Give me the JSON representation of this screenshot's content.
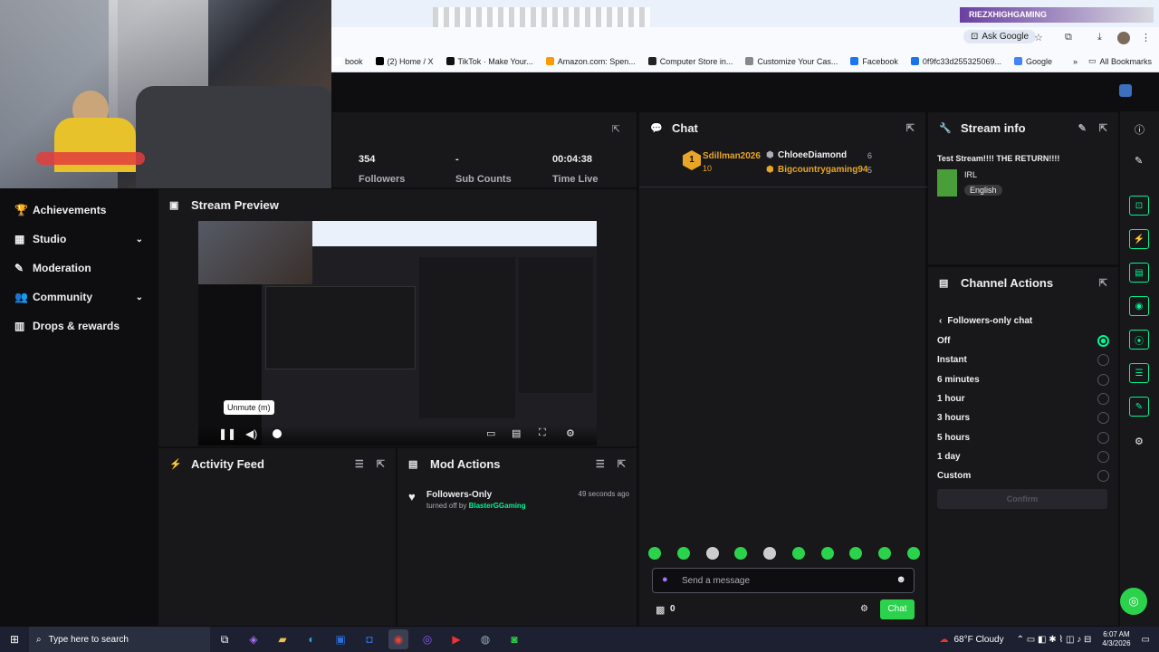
{
  "browser": {
    "profile_banner": "RIEZXHIGHGAMING",
    "ask_google": "Ask Google",
    "bookmarks": [
      {
        "label": "book",
        "color": "#ffffff"
      },
      {
        "label": "(2) Home / X",
        "color": "#000000"
      },
      {
        "label": "TikTok · Make Your...",
        "color": "#111111"
      },
      {
        "label": "Amazon.com: Spen...",
        "color": "#ff9900"
      },
      {
        "label": "Computer Store in...",
        "color": "#222222"
      },
      {
        "label": "Customize Your Cas...",
        "color": "#888888"
      },
      {
        "label": "Facebook",
        "color": "#1877f2"
      },
      {
        "label": "0f9fc33d255325069...",
        "color": "#1a73e8"
      },
      {
        "label": "Google",
        "color": "#4285f4"
      }
    ],
    "all_bookmarks": "All Bookmarks"
  },
  "sidebar": {
    "items": [
      {
        "label": "Achievements",
        "icon": "trophy-icon",
        "chevron": false
      },
      {
        "label": "Studio",
        "icon": "studio-icon",
        "chevron": true
      },
      {
        "label": "Moderation",
        "icon": "wrench-icon",
        "chevron": false
      },
      {
        "label": "Community",
        "icon": "community-icon",
        "chevron": true
      },
      {
        "label": "Drops & rewards",
        "icon": "drops-icon",
        "chevron": false
      }
    ]
  },
  "stats": {
    "followers_value": "354",
    "followers_label": "Followers",
    "subs_value": "-",
    "subs_label": "Sub Counts",
    "time_value": "00:04:38",
    "time_label": "Time Live"
  },
  "preview": {
    "title": "Stream Preview",
    "tooltip": "Unmute (m)"
  },
  "activity": {
    "title": "Activity Feed"
  },
  "mod_actions": {
    "title": "Mod Actions",
    "entries": [
      {
        "title": "Followers-Only",
        "detail_prefix": "turned off by",
        "actor": "BlasterGGaming",
        "time": "49 seconds ago"
      }
    ]
  },
  "chat": {
    "title": "Chat",
    "leaders": [
      {
        "rank": "1",
        "name": "Sdillman2026",
        "count": "10"
      },
      {
        "name": "ChloeeDiamond",
        "count": "6"
      },
      {
        "name": "Bigcountrygaming94",
        "count": "5"
      }
    ],
    "placeholder": "Send a message",
    "points": "0",
    "send_label": "Chat"
  },
  "stream_info": {
    "title": "Stream info",
    "stream_title": "Test Stream!!!! THE RETURN!!!!",
    "category": "IRL",
    "language": "English"
  },
  "channel_actions": {
    "title": "Channel Actions",
    "back_label": "Followers-only chat",
    "options": [
      "Off",
      "Instant",
      "6 minutes",
      "1 hour",
      "3 hours",
      "5 hours",
      "1 day",
      "Custom"
    ],
    "selected": "Off",
    "confirm_label": "Confirm"
  },
  "taskbar": {
    "search_placeholder": "Type here to search",
    "weather": "68°F  Cloudy",
    "time": "6:07 AM",
    "date": "4/3/2026"
  },
  "colors": {
    "accent": "#00f593",
    "gold": "#e9a626",
    "mod_green": "#00f593",
    "panel": "#18181b"
  }
}
